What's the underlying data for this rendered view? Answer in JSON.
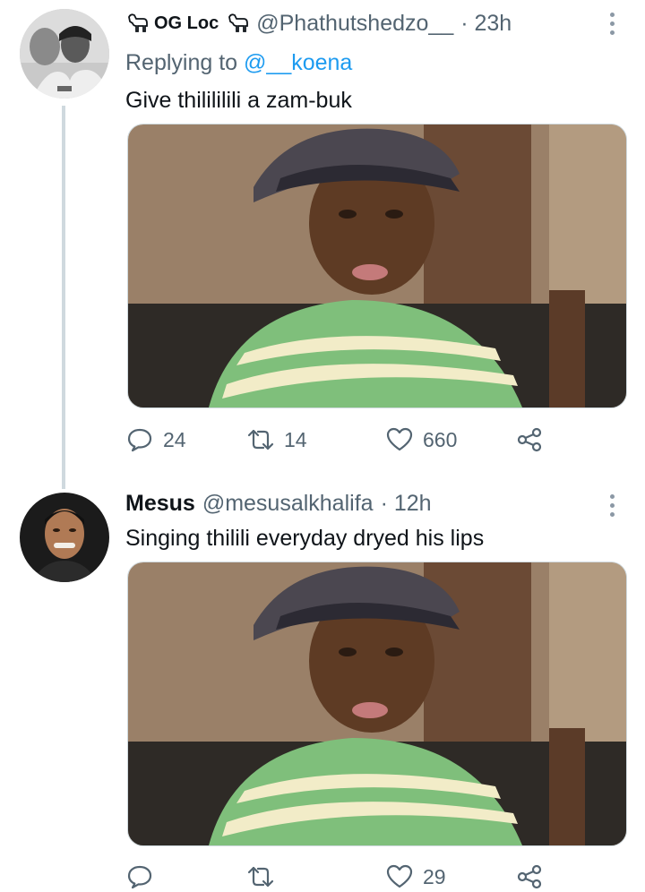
{
  "tweets": [
    {
      "display_name": "OG Loc",
      "handle": "@Phathutshedzo__",
      "time": "· 23h",
      "replying_prefix": "Replying to",
      "replying_to": "@__koena",
      "text": "Give thilililili a zam-buk",
      "reply_count": "24",
      "retweet_count": "14",
      "like_count": "660"
    },
    {
      "display_name": "Mesus",
      "handle": "@mesusalkhalifa",
      "time": "· 12h",
      "text": "Singing thilili everyday dryed his lips",
      "reply_count": "",
      "retweet_count": "",
      "like_count": "29"
    }
  ],
  "icons": {
    "reply": "reply-icon",
    "retweet": "retweet-icon",
    "like": "heart-icon",
    "share": "share-icon",
    "more": "more-options-icon",
    "name_emoji": "goat-emoji-icon"
  },
  "colors": {
    "link": "#1d9bf0",
    "secondary_text": "#536471",
    "thread_line": "#cfd9de"
  }
}
